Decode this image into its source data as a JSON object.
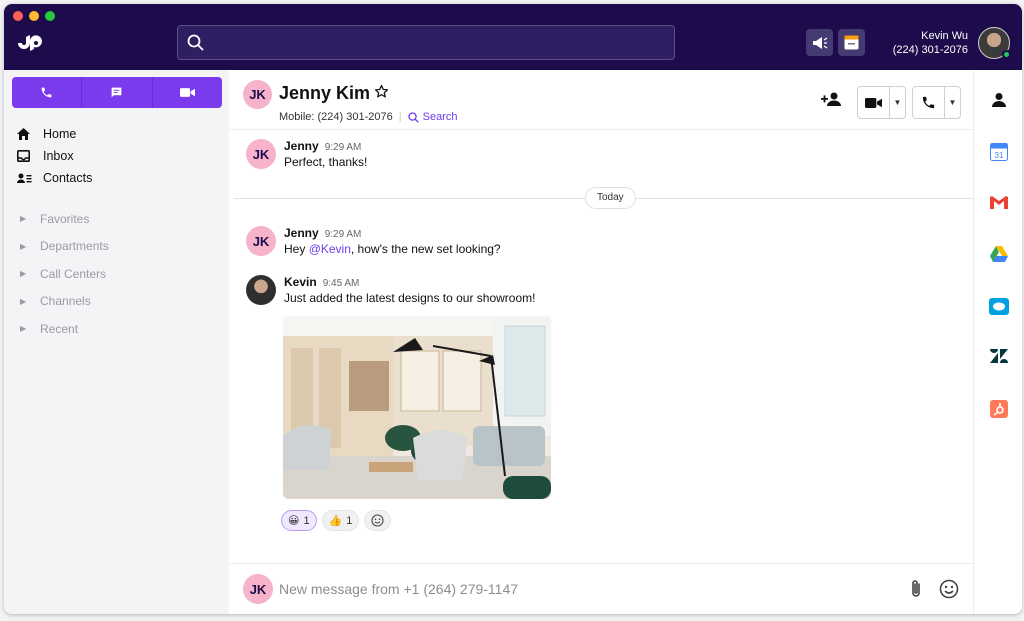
{
  "topbar": {
    "search_placeholder": "",
    "user_name": "Kevin Wu",
    "user_phone": "(224) 301-2076"
  },
  "sidebar": {
    "actions": [
      "phone",
      "message",
      "video"
    ],
    "nav": [
      {
        "label": "Home",
        "icon": "home-icon"
      },
      {
        "label": "Inbox",
        "icon": "inbox-icon"
      },
      {
        "label": "Contacts",
        "icon": "contacts-icon"
      }
    ],
    "sections": [
      "Favorites",
      "Departments",
      "Call Centers",
      "Channels",
      "Recent"
    ]
  },
  "chat": {
    "contact_initials": "JK",
    "contact_name": "Jenny Kim",
    "contact_mobile": "Mobile: (224) 301-2076",
    "search_label": "Search",
    "divider_label": "Today",
    "messages": [
      {
        "sender": "Jenny",
        "time": "9:29 AM",
        "text": "Perfect, thanks!"
      },
      {
        "sender": "Jenny",
        "time": "9:29 AM",
        "text_before": "Hey ",
        "mention": "@Kevin",
        "text_after": ", how's the new set looking?"
      },
      {
        "sender": "Kevin",
        "time": "9:45 AM",
        "text": "Just added the latest designs to our showroom!"
      }
    ],
    "reactions": [
      {
        "emoji": "😀",
        "count": "1"
      },
      {
        "emoji": "👍",
        "count": "1"
      }
    ],
    "composer_placeholder": "New message from +1 (264) 279-1147"
  },
  "colors": {
    "topbar": "#1e0b4b",
    "accent": "#7c3aed",
    "avatar_pink": "#f6b3cb"
  },
  "rail": [
    "contact-info-icon",
    "calendar-icon",
    "gmail-icon",
    "drive-icon",
    "salesforce-icon",
    "zendesk-icon",
    "hubspot-icon"
  ]
}
